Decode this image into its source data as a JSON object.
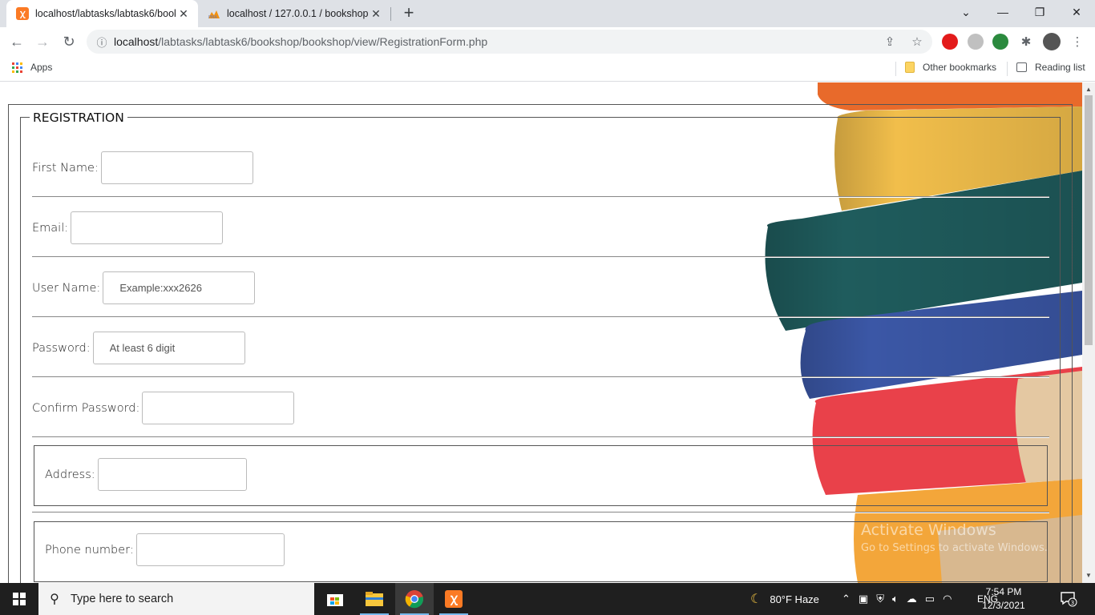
{
  "browser": {
    "tabs": [
      {
        "title": "localhost/labtasks/labtask6/book",
        "active": true
      },
      {
        "title": "localhost / 127.0.0.1 / bookshop",
        "active": false
      }
    ],
    "url_host": "localhost",
    "url_path": "/labtasks/labtask6/bookshop/bookshop/view/RegistrationForm.php"
  },
  "bookmarks": {
    "apps": "Apps",
    "other": "Other bookmarks",
    "reading": "Reading list"
  },
  "form": {
    "legend": "REGISTRATION",
    "first_name": {
      "label": "First Name:",
      "value": "",
      "placeholder": ""
    },
    "email": {
      "label": "Email:",
      "value": "",
      "placeholder": ""
    },
    "username": {
      "label": "User Name:",
      "value": "",
      "placeholder": "Example:xxx2626"
    },
    "password": {
      "label": "Password:",
      "value": "",
      "placeholder": "At least 6 digit"
    },
    "confirm_password": {
      "label": "Confirm Password:",
      "value": "",
      "placeholder": ""
    },
    "address": {
      "label": "Address:",
      "value": "",
      "placeholder": ""
    },
    "phone": {
      "label": "Phone number:",
      "value": "",
      "placeholder": ""
    }
  },
  "watermark": {
    "title": "Activate Windows",
    "subtitle": "Go to Settings to activate Windows."
  },
  "taskbar": {
    "search_placeholder": "Type here to search",
    "weather": "80°F  Haze",
    "lang": "ENG",
    "time": "7:54 PM",
    "date": "12/3/2021",
    "notifications": "3"
  },
  "colors": {
    "xampp": "#fb7a24",
    "chrome_tab_bg": "#dee1e6",
    "taskbar": "#1f1f1f"
  }
}
